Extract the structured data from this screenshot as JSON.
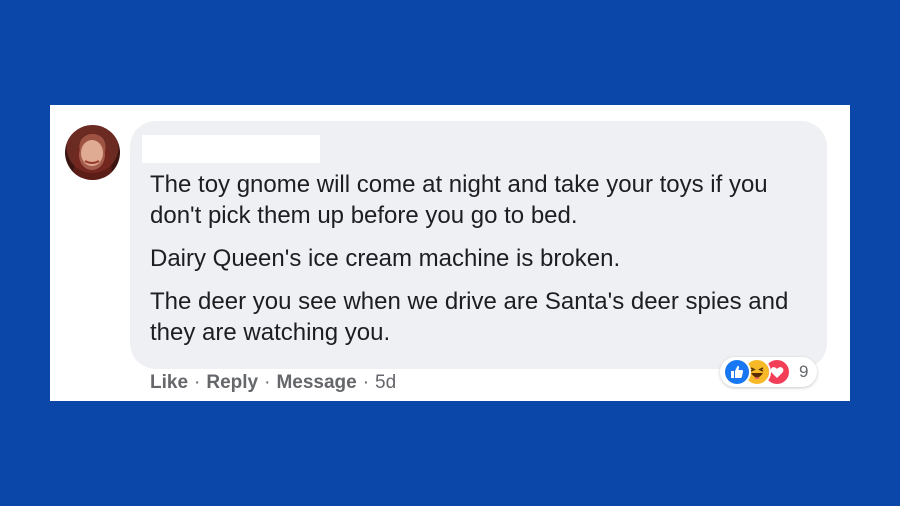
{
  "comment": {
    "lines": [
      "The toy gnome will come at night and take your toys if you don't pick them up before you go to bed.",
      "Dairy Queen's ice cream machine is broken.",
      "The deer you see when we drive are Santa's deer spies and they are watching you."
    ]
  },
  "actions": {
    "like": "Like",
    "reply": "Reply",
    "message": "Message",
    "separator": "·",
    "time": "5d"
  },
  "reactions": {
    "count": "9",
    "icons": [
      "like-icon",
      "haha-icon",
      "love-icon"
    ]
  },
  "colors": {
    "background": "#0a47a9",
    "bubble": "#eef0f3",
    "like": "#1877f2",
    "haha": "#f7b928",
    "love": "#f33e58"
  }
}
